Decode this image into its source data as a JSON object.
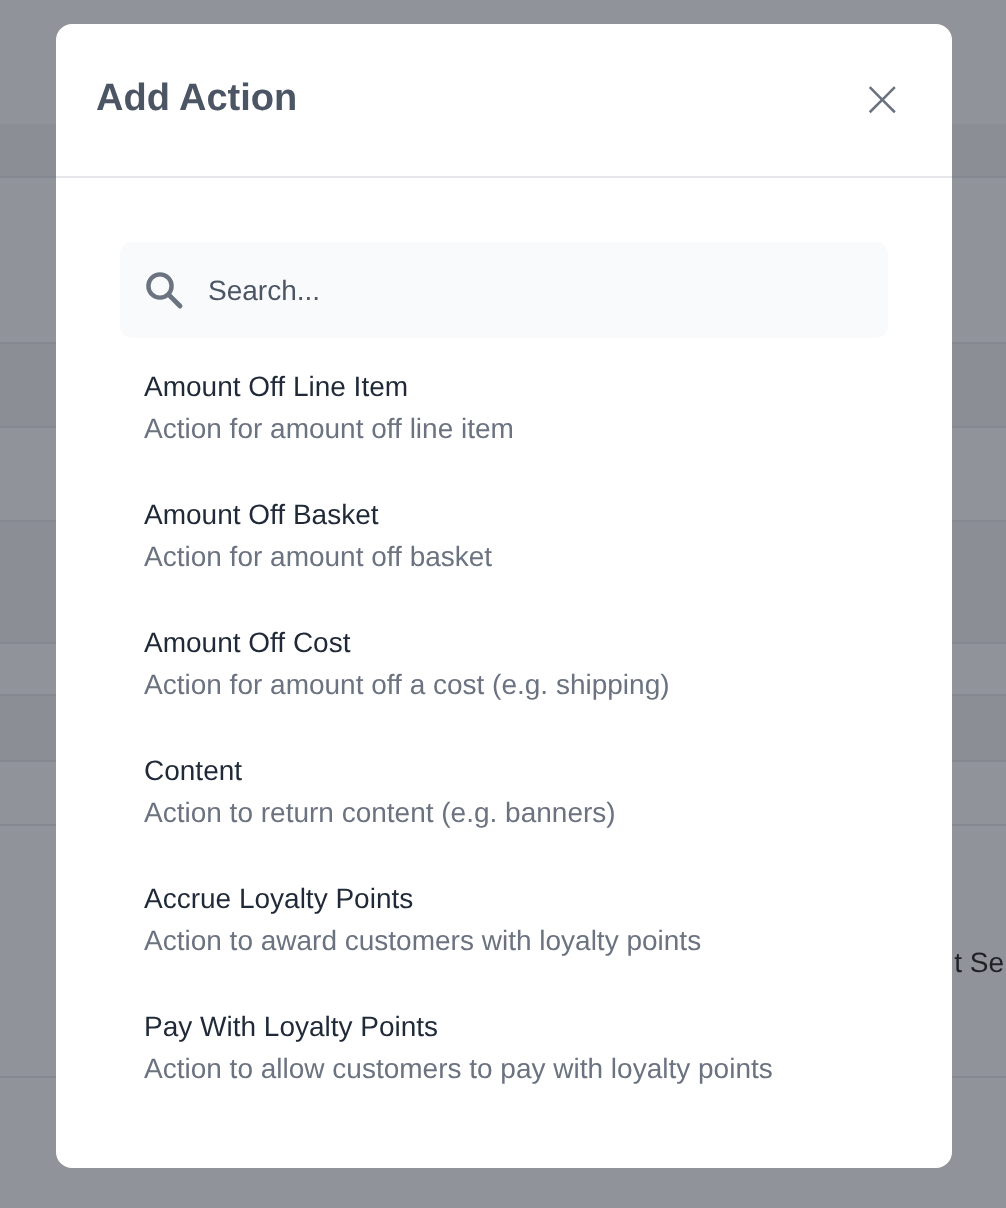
{
  "background": {
    "text": "t Se"
  },
  "dialog": {
    "title": "Add Action",
    "close": "×",
    "search": {
      "placeholder": "Search..."
    },
    "actions": [
      {
        "title": "Amount Off Line Item",
        "description": "Action for amount off line item"
      },
      {
        "title": "Amount Off Basket",
        "description": "Action for amount off basket"
      },
      {
        "title": "Amount Off Cost",
        "description": "Action for amount off a cost (e.g. shipping)"
      },
      {
        "title": "Content",
        "description": "Action to return content (e.g. banners)"
      },
      {
        "title": "Accrue Loyalty Points",
        "description": "Action to award customers with loyalty points"
      },
      {
        "title": "Pay With Loyalty Points",
        "description": "Action to allow customers to pay with loyalty points"
      }
    ]
  }
}
